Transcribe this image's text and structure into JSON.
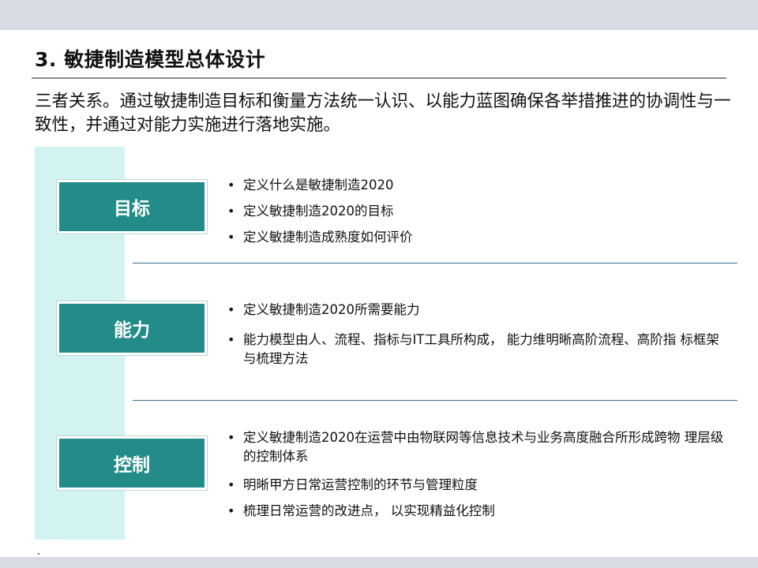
{
  "header": {
    "title": "3. 敏捷制造模型总体设计"
  },
  "intro": {
    "text": "三者关系。通过敏捷制造目标和衡量方法统一认识、以能力蓝图确保各举措推进的协调性与一致性，并通过对能力实施进行落地实施。"
  },
  "sections": [
    {
      "label": "目标",
      "bullets": [
        "定义什么是敏捷制造2020",
        "定义敏捷制造2020的目标",
        "定义敏捷制造成熟度如何评价"
      ]
    },
    {
      "label": "能力",
      "bullets": [
        "定义敏捷制造2020所需要能力",
        "能力模型由人、流程、指标与IT工具所构成， 能力维明晰高阶流程、高阶指 标框架与梳理方法"
      ]
    },
    {
      "label": "控制",
      "bullets": [
        "定义敏捷制造2020在运营中由物联网等信息技术与业务高度融合所形成跨物 理层级的控制体系",
        "明晰甲方日常运营控制的环节与管理粒度",
        "梳理日常运营的改进点， 以实现精益化控制"
      ]
    }
  ],
  "colors": {
    "label_fill": "#238c88",
    "panel_fill": "#d3f2f2",
    "band_fill": "#d6dbe4",
    "divider": "#3d6f8c"
  }
}
